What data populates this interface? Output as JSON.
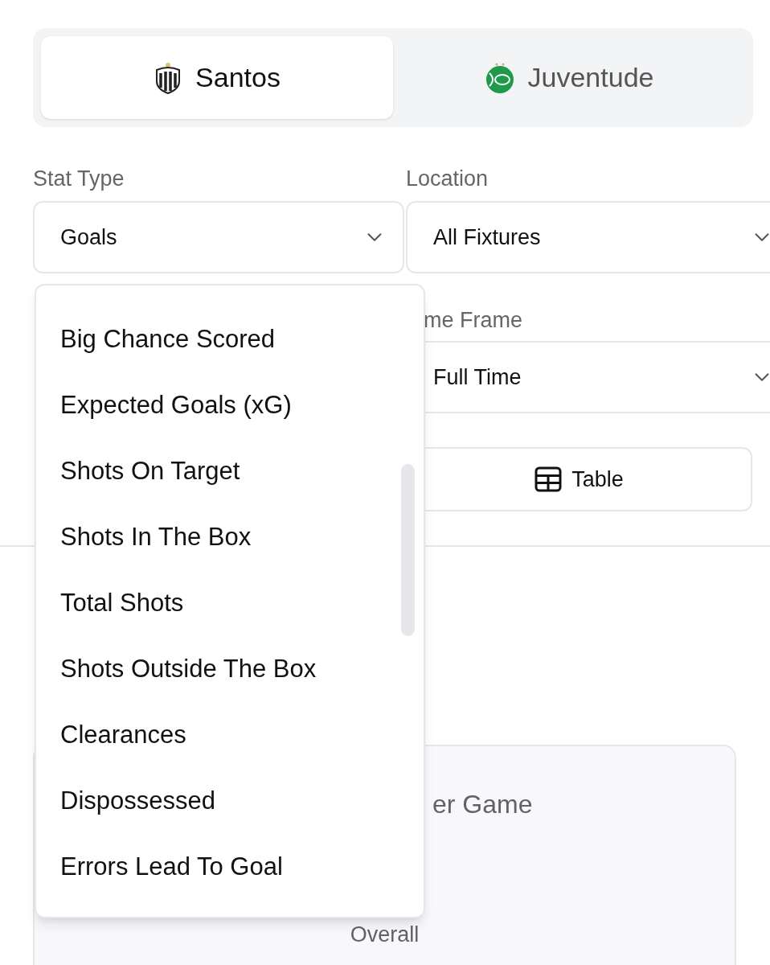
{
  "team_tabs": [
    {
      "label": "Santos",
      "selected": true,
      "kind": "santos"
    },
    {
      "label": "Juventude",
      "selected": false,
      "kind": "juventude"
    }
  ],
  "filters": {
    "stat_type": {
      "label": "Stat Type",
      "value": "Goals"
    },
    "location": {
      "label": "Location",
      "value": "All Fixtures"
    },
    "time_frame": {
      "label": "me Frame",
      "value": "Full Time"
    }
  },
  "view_button": {
    "label": "Table"
  },
  "stat_card": {
    "title": "er Game",
    "subtitle": "Overall"
  },
  "stat_type_menu": {
    "options": [
      "Big Chance Scored",
      "Expected Goals (xG)",
      "Shots On Target",
      "Shots In The Box",
      "Total Shots",
      "Shots Outside The Box",
      "Clearances",
      "Dispossessed",
      "Errors Lead To Goal"
    ]
  }
}
